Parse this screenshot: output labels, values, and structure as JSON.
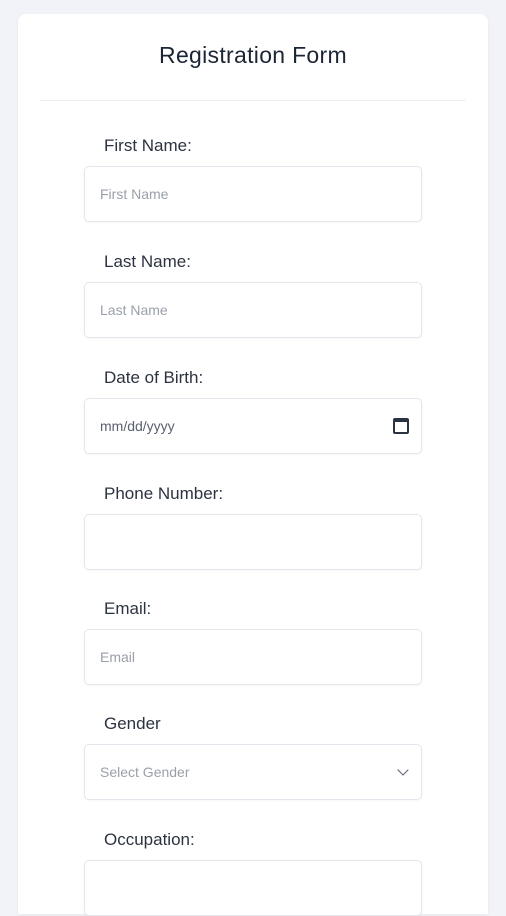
{
  "form": {
    "title": "Registration Form",
    "fields": [
      {
        "label": "First Name:",
        "placeholder": "First Name",
        "type": "text"
      },
      {
        "label": "Last Name:",
        "placeholder": "Last Name",
        "type": "text"
      },
      {
        "label": "Date of Birth:",
        "placeholder": "mm/dd/yyyy",
        "type": "date",
        "icon": "calendar-icon"
      },
      {
        "label": "Phone Number:",
        "placeholder": "",
        "type": "tel"
      },
      {
        "label": "Email:",
        "placeholder": "Email",
        "type": "email"
      },
      {
        "label": "Gender",
        "placeholder": "Select Gender",
        "type": "select",
        "icon": "chevron-down-icon"
      },
      {
        "label": "Occupation:",
        "placeholder": "",
        "type": "text"
      }
    ]
  }
}
